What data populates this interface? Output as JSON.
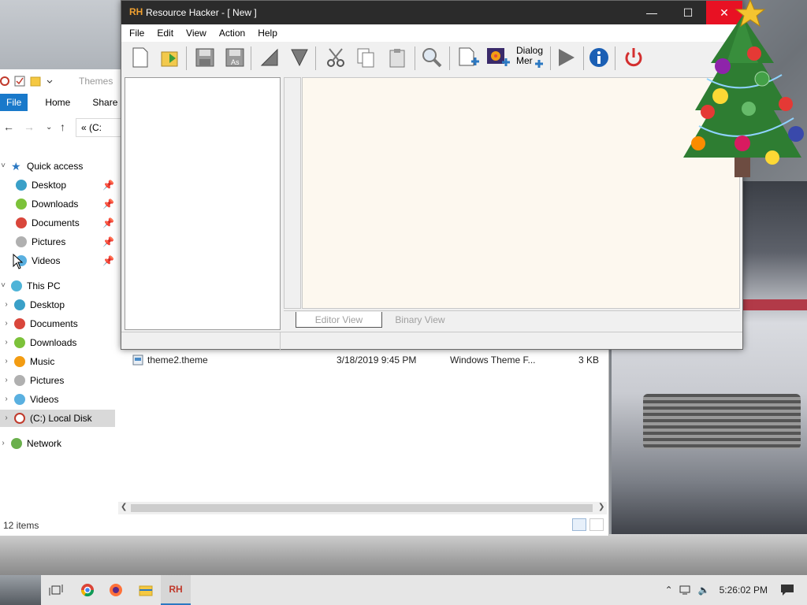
{
  "rh_window": {
    "logo": "RH",
    "title": "Resource Hacker - [ New ]",
    "menu": [
      "File",
      "Edit",
      "View",
      "Action",
      "Help"
    ],
    "toolbar": {
      "dialog_label_line1": "Dialog",
      "dialog_label_line2": "Mer"
    },
    "tabs": {
      "editor": "Editor View",
      "binary": "Binary View"
    },
    "colors": {
      "titlebar": "#2b2b2b",
      "close": "#e81123",
      "editor_bg": "#fdf8ef"
    }
  },
  "explorer": {
    "title": "Themes",
    "ribbon_tabs": [
      "File",
      "Home",
      "Share"
    ],
    "address": "« (C:",
    "nav": {
      "quick_access": "Quick access",
      "qa_items": [
        "Desktop",
        "Downloads",
        "Documents",
        "Pictures",
        "Videos"
      ],
      "this_pc": "This PC",
      "pc_items": [
        "Desktop",
        "Documents",
        "Downloads",
        "Music",
        "Pictures",
        "Videos",
        "(C:) Local Disk"
      ],
      "network": "Network"
    },
    "file": {
      "name": "theme2.theme",
      "date": "3/18/2019 9:45 PM",
      "type": "Windows Theme F...",
      "size": "3 KB"
    },
    "status": "12 items"
  },
  "taskbar": {
    "clock": "5:26:02 PM",
    "rh_label": "RH"
  }
}
